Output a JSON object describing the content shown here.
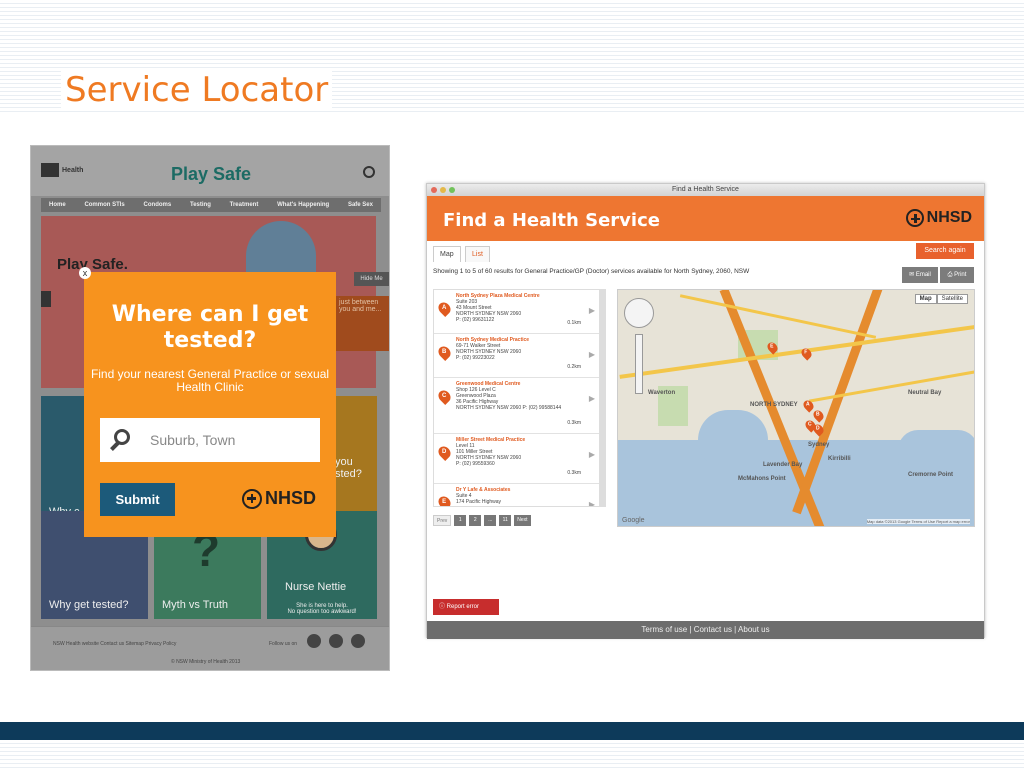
{
  "slide": {
    "title": "Service Locator"
  },
  "playsafe": {
    "logo_text": "Health",
    "logo_box_text": "NSW",
    "brand": "Play Safe",
    "nav": [
      "Home",
      "Common STIs",
      "Condoms",
      "Testing",
      "Treatment",
      "What's Happening",
      "Safe Sex"
    ],
    "hero_title": "Play Safe.",
    "hero_partial": "W\nPr\nyo",
    "hide_me": "Hide Me",
    "side_note": "just between you and me...",
    "tiles": {
      "why_c": "Why c",
      "you_tested": "you\nsted?",
      "why_get_tested": "Why get tested?",
      "myth_vs_truth": "Myth vs Truth",
      "nurse_nettie": "Nurse Nettie",
      "nurse_nettie_sub": "She is here to help.\nNo question too awkward!"
    },
    "footer_links": "NSW Health website   Contact us   Sitemap   Privacy Policy",
    "follow": "Follow us on",
    "copyright": "© NSW Ministry of Health 2013"
  },
  "popup": {
    "close": "x",
    "heading": "Where can I get tested?",
    "subtext": "Find your nearest General Practice or sexual Health Clinic",
    "search_placeholder": "Suburb, Town",
    "submit": "Submit",
    "logo": "NHSD"
  },
  "finder": {
    "window_title": "Find a Health Service",
    "header_title": "Find a Health Service",
    "logo": "NHSD",
    "tabs": [
      "Map",
      "List"
    ],
    "search_again": "Search again",
    "results_text": "Showing 1 to 5 of 60 results for General Practice/GP (Doctor) services available for North Sydney, 2060, NSW",
    "email": "Email",
    "print": "Print",
    "results": [
      {
        "pin": "A",
        "name": "North Sydney Plaza Medical Centre",
        "line1": "Suite 203",
        "line2": "43 Mount Street",
        "line3": "NORTH SYDNEY NSW 2060",
        "phone": "P: (02) 99631122",
        "dist": "0.1km"
      },
      {
        "pin": "B",
        "name": "North Sydney Medical Practice",
        "line1": "69-71 Walker Street",
        "line2": "NORTH SYDNEY NSW 2060",
        "line3": "",
        "phone": "P: (02) 99223022",
        "dist": "0.2km"
      },
      {
        "pin": "C",
        "name": "Greenwood Medical Centre",
        "line1": "Shop 126 Level C",
        "line2": "Greenwood Plaza",
        "line3": "36 Pacific Highway",
        "phone": "NORTH SYDNEY NSW 2060  P: (02) 99588144",
        "dist": "0.3km"
      },
      {
        "pin": "D",
        "name": "Miller Street Medical Practice",
        "line1": "Level 11",
        "line2": "101 Miller Street",
        "line3": "NORTH SYDNEY NSW 2060",
        "phone": "P: (02) 99559360",
        "dist": "0.3km"
      },
      {
        "pin": "E",
        "name": "Dr Y Lafe & Associates",
        "line1": "Suite 4",
        "line2": "174 Pacific Highway",
        "line3": "",
        "phone": "",
        "dist": ""
      }
    ],
    "pages": [
      "Prev",
      "1",
      "2",
      "...",
      "11",
      "Next"
    ],
    "map_types": [
      "Map",
      "Satellite"
    ],
    "map_labels": [
      "NORTH SYDNEY",
      "Waverton",
      "Sydney",
      "Kirribilli",
      "Neutral Bay",
      "Lavender Bay",
      "McMahons Point",
      "Cremorne Point"
    ],
    "map_pins": [
      "A",
      "B",
      "C",
      "D",
      "E",
      "F"
    ],
    "google": "Google",
    "map_attr": "Map data ©2013 Google   Terms of Use   Report a map error",
    "report_error": "Report error",
    "footer": "Terms of use | Contact us | About us"
  }
}
